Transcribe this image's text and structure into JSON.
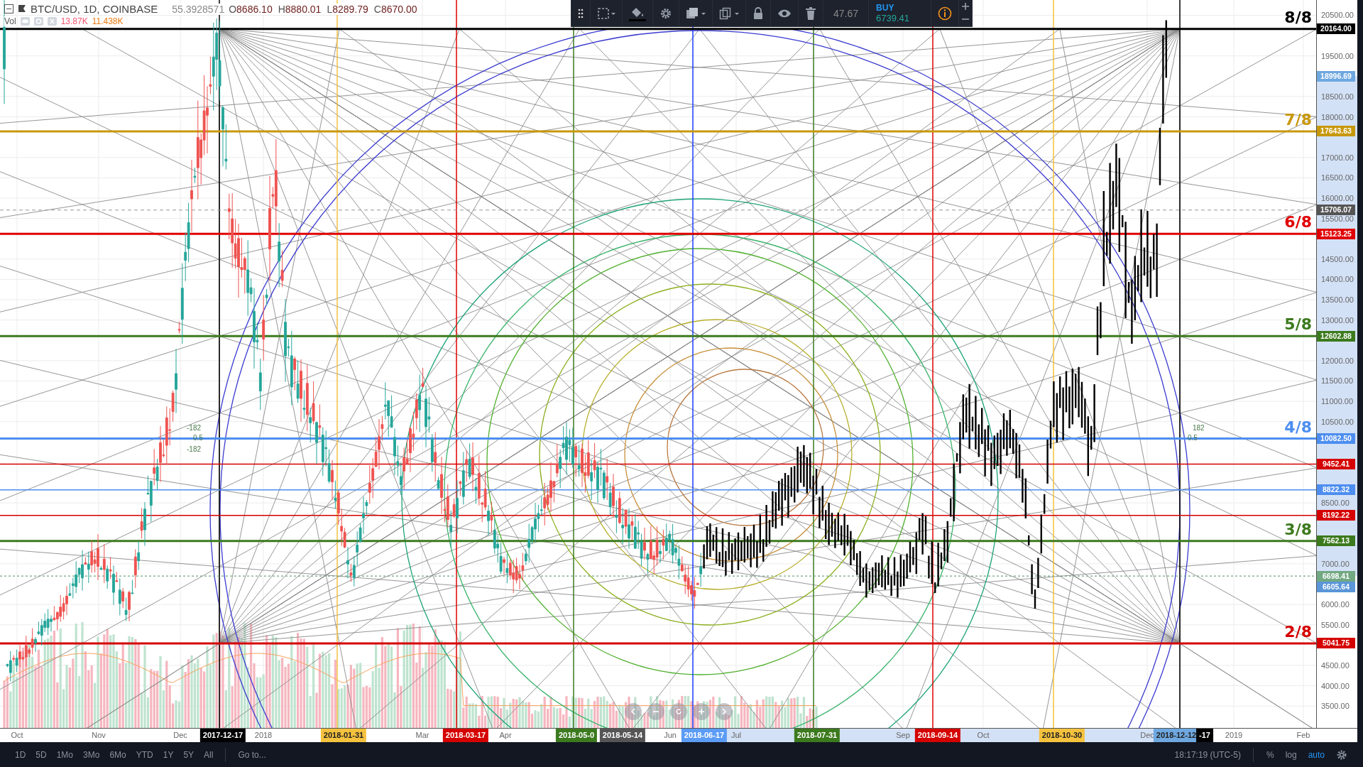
{
  "legend": {
    "symbol": "BTC/USD, 1D, COINBASE",
    "indicator_value": "55.3928571",
    "ohlc": [
      {
        "label": "O",
        "value": "8686.10"
      },
      {
        "label": "H",
        "value": "8880.01"
      },
      {
        "label": "L",
        "value": "8289.79"
      },
      {
        "label": "C",
        "value": "8670.00"
      }
    ],
    "volume_label": "Vol",
    "volume_values": [
      {
        "text": "13.87K",
        "color": "#f0546e"
      },
      {
        "text": "11.438K",
        "color": "#e87a10"
      }
    ]
  },
  "drawing_toolbar": {
    "value": "47.67",
    "order_side": "BUY",
    "price": "6739.41"
  },
  "chart_labels": [
    {
      "text": "-182",
      "kind": "left"
    },
    {
      "text": "0.5",
      "kind": "left"
    },
    {
      "text": "-182",
      "kind": "left"
    },
    {
      "text": "182",
      "kind": "right"
    },
    {
      "text": "0.5",
      "kind": "right"
    }
  ],
  "price_axis": {
    "ticks": [
      "20500.00",
      "19500.00",
      "18500.00",
      "18000.00",
      "17000.00",
      "16500.00",
      "16000.00",
      "15500.00",
      "14500.00",
      "14000.00",
      "13500.00",
      "13000.00",
      "12000.00",
      "11500.00",
      "11000.00",
      "10500.00",
      "8500.00",
      "7000.00",
      "6000.00",
      "5500.00",
      "4500.00",
      "4000.00",
      "3500.00"
    ],
    "tags": [
      {
        "text": "20164.00",
        "color": "#000000",
        "kind": "level",
        "level_label": "8/8"
      },
      {
        "text": "18996.69",
        "color": "#6fa8e0",
        "kind": "marker"
      },
      {
        "text": "17643.63",
        "color": "#c8980c",
        "kind": "level",
        "level_label": "7/8"
      },
      {
        "text": "15706.07",
        "color": "#555555",
        "kind": "crosshair"
      },
      {
        "text": "15123.25",
        "color": "#e00000",
        "kind": "level",
        "level_label": "6/8"
      },
      {
        "text": "12602.88",
        "color": "#3c7a1e",
        "kind": "level",
        "level_label": "5/8"
      },
      {
        "text": "10082.50",
        "color": "#4d8ef0",
        "kind": "level",
        "level_label": "4/8"
      },
      {
        "text": "9452.41",
        "color": "#d50000",
        "kind": "line"
      },
      {
        "text": "8822.32",
        "color": "#4d8ef0",
        "kind": "line"
      },
      {
        "text": "8192.22",
        "color": "#d50000",
        "kind": "line"
      },
      {
        "text": "7562.13",
        "color": "#3c7a1e",
        "kind": "level",
        "level_label": "3/8"
      },
      {
        "text": "6698.41",
        "color": "#72a882",
        "kind": "dotted"
      },
      {
        "text": "6605.64",
        "color": "#5a96d8",
        "kind": "marker"
      },
      {
        "text": "5041.75",
        "color": "#d50000",
        "kind": "level",
        "level_label": "2/8"
      }
    ]
  },
  "time_axis": {
    "labels": [
      "Oct",
      "Nov",
      "Dec",
      "2018",
      "Mar",
      "Apr",
      "Jun",
      "Jul",
      "Sep",
      "Oct",
      "Dec",
      "2019",
      "Feb"
    ],
    "tags": [
      {
        "text": "2017-12-17",
        "color": "#000000"
      },
      {
        "text": "2018-01-31",
        "color": "#f5c23e"
      },
      {
        "text": "2018-03-17",
        "color": "#d50000"
      },
      {
        "text": "2018-05-0",
        "color": "#3c7a1e"
      },
      {
        "text": "2018-05-14",
        "color": "#555555"
      },
      {
        "text": "2018-06-17",
        "color": "#5b9cf6"
      },
      {
        "text": "2018-07-31",
        "color": "#3c7a1e"
      },
      {
        "text": "2018-09-14",
        "color": "#d50000"
      },
      {
        "text": "2018-10-30",
        "color": "#f5c23e"
      },
      {
        "text": "2018-12-12",
        "color": "#6fa8e0"
      },
      {
        "text": "-17",
        "color": "#000000"
      }
    ]
  },
  "range_buttons": [
    "1D",
    "5D",
    "1Mo",
    "3Mo",
    "6Mo",
    "YTD",
    "1Y",
    "5Y",
    "All"
  ],
  "goto": "Go to...",
  "clock": "18:17:19 (UTC-5)",
  "scale_buttons": [
    {
      "label": "%",
      "on": false
    },
    {
      "label": "log",
      "on": false
    },
    {
      "label": "auto",
      "on": true
    }
  ]
}
